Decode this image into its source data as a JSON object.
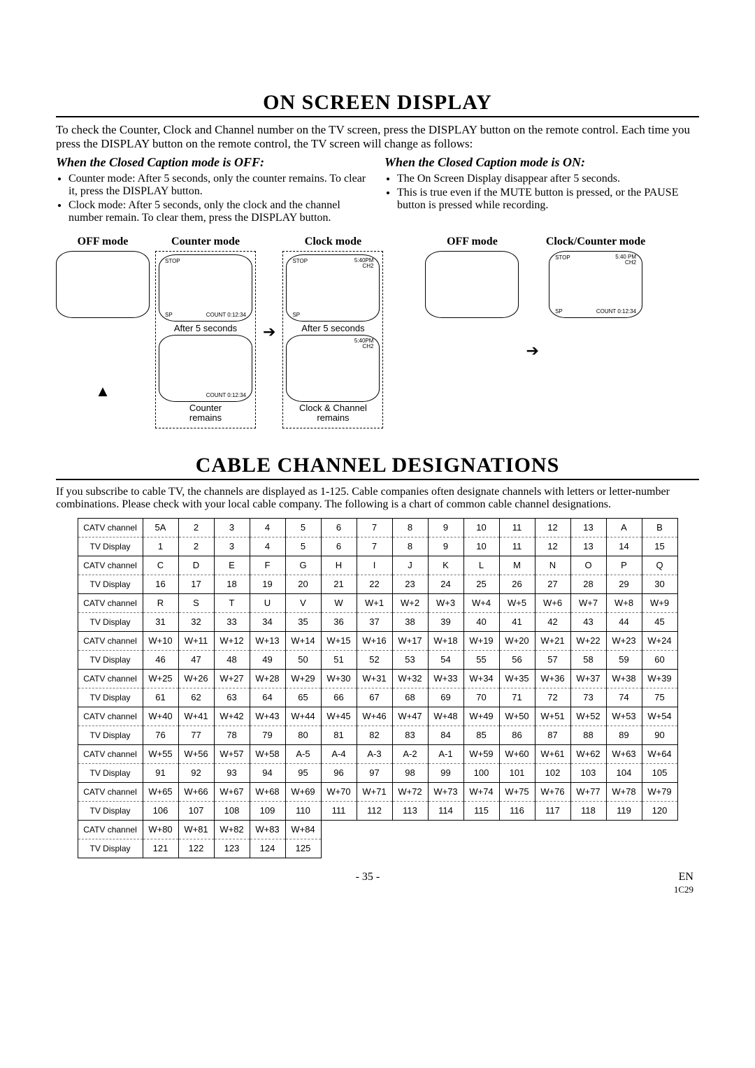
{
  "section1": {
    "title": "ON SCREEN DISPLAY",
    "intro": "To check the Counter, Clock and Channel number on the TV screen, press the DISPLAY button on the remote control. Each time you press the DISPLAY button on the remote control, the TV screen will change as follows:",
    "left": {
      "heading": "When the Closed Caption mode is OFF:",
      "bullets": [
        "Counter mode: After 5 seconds, only the counter remains. To clear it, press the DISPLAY button.",
        "Clock mode: After 5 seconds, only the clock and the channel number remain. To clear them, press the DISPLAY button."
      ]
    },
    "right": {
      "heading": "When the Closed Caption mode is ON:",
      "bullets": [
        "The On Screen Display disappear after 5 seconds.",
        "This is true even if the MUTE button is pressed, or the PAUSE button is pressed while recording."
      ]
    },
    "labels": {
      "off_mode": "OFF mode",
      "counter_mode": "Counter mode",
      "clock_mode": "Clock mode",
      "clock_counter_mode": "Clock/Counter mode",
      "after5": "After 5 seconds",
      "counter_remains": "Counter\nremains",
      "clock_channel_remains": "Clock & Channel\nremains"
    },
    "screen": {
      "stop": "STOP",
      "sp": "SP",
      "count": "COUNT  0:12:34",
      "time": "5:40PM",
      "time_sp": "5:40 PM",
      "ch": "CH2"
    }
  },
  "section2": {
    "title": "CABLE CHANNEL DESIGNATIONS",
    "intro": "If you subscribe to cable TV, the channels are displayed as 1-125. Cable companies often designate channels with letters or letter-number combinations. Please check with your local cable company. The following is a chart of common cable channel designations.",
    "row_labels": {
      "catv": "CATV channel",
      "tvd": "TV Display"
    },
    "rows": [
      {
        "catv": [
          "5A",
          "2",
          "3",
          "4",
          "5",
          "6",
          "7",
          "8",
          "9",
          "10",
          "11",
          "12",
          "13",
          "A",
          "B"
        ],
        "tvd": [
          "1",
          "2",
          "3",
          "4",
          "5",
          "6",
          "7",
          "8",
          "9",
          "10",
          "11",
          "12",
          "13",
          "14",
          "15"
        ]
      },
      {
        "catv": [
          "C",
          "D",
          "E",
          "F",
          "G",
          "H",
          "I",
          "J",
          "K",
          "L",
          "M",
          "N",
          "O",
          "P",
          "Q"
        ],
        "tvd": [
          "16",
          "17",
          "18",
          "19",
          "20",
          "21",
          "22",
          "23",
          "24",
          "25",
          "26",
          "27",
          "28",
          "29",
          "30"
        ]
      },
      {
        "catv": [
          "R",
          "S",
          "T",
          "U",
          "V",
          "W",
          "W+1",
          "W+2",
          "W+3",
          "W+4",
          "W+5",
          "W+6",
          "W+7",
          "W+8",
          "W+9"
        ],
        "tvd": [
          "31",
          "32",
          "33",
          "34",
          "35",
          "36",
          "37",
          "38",
          "39",
          "40",
          "41",
          "42",
          "43",
          "44",
          "45"
        ]
      },
      {
        "catv": [
          "W+10",
          "W+11",
          "W+12",
          "W+13",
          "W+14",
          "W+15",
          "W+16",
          "W+17",
          "W+18",
          "W+19",
          "W+20",
          "W+21",
          "W+22",
          "W+23",
          "W+24"
        ],
        "tvd": [
          "46",
          "47",
          "48",
          "49",
          "50",
          "51",
          "52",
          "53",
          "54",
          "55",
          "56",
          "57",
          "58",
          "59",
          "60"
        ]
      },
      {
        "catv": [
          "W+25",
          "W+26",
          "W+27",
          "W+28",
          "W+29",
          "W+30",
          "W+31",
          "W+32",
          "W+33",
          "W+34",
          "W+35",
          "W+36",
          "W+37",
          "W+38",
          "W+39"
        ],
        "tvd": [
          "61",
          "62",
          "63",
          "64",
          "65",
          "66",
          "67",
          "68",
          "69",
          "70",
          "71",
          "72",
          "73",
          "74",
          "75"
        ]
      },
      {
        "catv": [
          "W+40",
          "W+41",
          "W+42",
          "W+43",
          "W+44",
          "W+45",
          "W+46",
          "W+47",
          "W+48",
          "W+49",
          "W+50",
          "W+51",
          "W+52",
          "W+53",
          "W+54"
        ],
        "tvd": [
          "76",
          "77",
          "78",
          "79",
          "80",
          "81",
          "82",
          "83",
          "84",
          "85",
          "86",
          "87",
          "88",
          "89",
          "90"
        ]
      },
      {
        "catv": [
          "W+55",
          "W+56",
          "W+57",
          "W+58",
          "A-5",
          "A-4",
          "A-3",
          "A-2",
          "A-1",
          "W+59",
          "W+60",
          "W+61",
          "W+62",
          "W+63",
          "W+64"
        ],
        "tvd": [
          "91",
          "92",
          "93",
          "94",
          "95",
          "96",
          "97",
          "98",
          "99",
          "100",
          "101",
          "102",
          "103",
          "104",
          "105"
        ]
      },
      {
        "catv": [
          "W+65",
          "W+66",
          "W+67",
          "W+68",
          "W+69",
          "W+70",
          "W+71",
          "W+72",
          "W+73",
          "W+74",
          "W+75",
          "W+76",
          "W+77",
          "W+78",
          "W+79"
        ],
        "tvd": [
          "106",
          "107",
          "108",
          "109",
          "110",
          "111",
          "112",
          "113",
          "114",
          "115",
          "116",
          "117",
          "118",
          "119",
          "120"
        ]
      },
      {
        "catv": [
          "W+80",
          "W+81",
          "W+82",
          "W+83",
          "W+84"
        ],
        "tvd": [
          "121",
          "122",
          "123",
          "124",
          "125"
        ]
      }
    ]
  },
  "footer": {
    "page": "- 35 -",
    "lang": "EN",
    "code": "1C29"
  }
}
